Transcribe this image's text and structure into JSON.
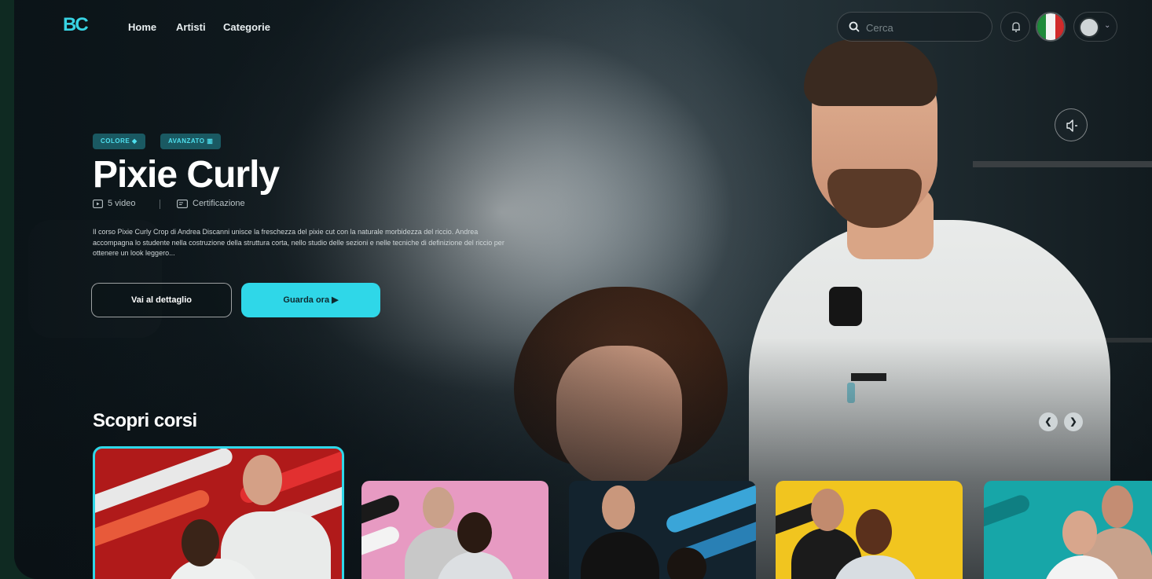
{
  "nav": {
    "logo": "BC",
    "links": [
      "Home",
      "Artisti",
      "Categorie"
    ],
    "search_placeholder": "Cerca"
  },
  "hero": {
    "tags": [
      {
        "label": "COLORE"
      },
      {
        "label": "AVANZATO"
      }
    ],
    "title": "Pixie Curly",
    "video_count": "5 video",
    "certification": "Certificazione",
    "description": "Il corso Pixie Curly Crop di Andrea Discanni unisce la freschezza del pixie cut con la naturale morbidezza del riccio. Andrea accompagna lo studente nella costruzione della struttura corta, nello studio delle sezioni e nelle tecniche di definizione del riccio per ottenere un look leggero...",
    "detail_button": "Vai al dettaglio",
    "watch_button": "Guarda ora"
  },
  "carousel": {
    "title": "Scopri corsi"
  },
  "colors": {
    "accent": "#2fd7e8",
    "background": "#0d1519",
    "tag_bg": "#1a5962"
  }
}
